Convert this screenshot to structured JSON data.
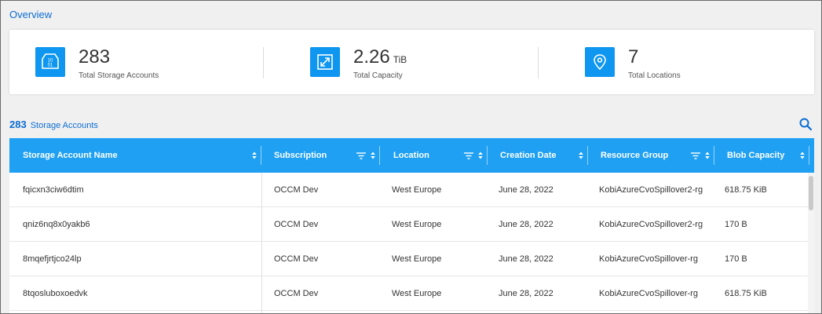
{
  "overview": {
    "title": "Overview"
  },
  "stats": [
    {
      "icon": "storage-account-icon",
      "value": "283",
      "unit": "",
      "caption": "Total Storage Accounts"
    },
    {
      "icon": "capacity-icon",
      "value": "2.26",
      "unit": "TiB",
      "caption": "Total Capacity"
    },
    {
      "icon": "location-pin-icon",
      "value": "7",
      "unit": "",
      "caption": "Total Locations"
    }
  ],
  "list": {
    "count": "283",
    "label": "Storage Accounts"
  },
  "colors": {
    "accent": "#0c6dd4",
    "header": "#1fa0f2",
    "tile": "#0e96f0"
  },
  "table": {
    "columns": [
      {
        "label": "Storage Account Name",
        "filter": false
      },
      {
        "label": "Subscription",
        "filter": true
      },
      {
        "label": "Location",
        "filter": true
      },
      {
        "label": "Creation Date",
        "filter": false
      },
      {
        "label": "Resource Group",
        "filter": true
      },
      {
        "label": "Blob Capacity",
        "filter": false
      }
    ],
    "rows": [
      [
        "fqicxn3ciw6dtim",
        "OCCM Dev",
        "West Europe",
        "June 28, 2022",
        "KobiAzureCvoSpillover2-rg",
        "618.75 KiB"
      ],
      [
        "qniz6nq8x0yakb6",
        "OCCM Dev",
        "West Europe",
        "June 28, 2022",
        "KobiAzureCvoSpillover2-rg",
        "170 B"
      ],
      [
        "8mqefjrtjco24lp",
        "OCCM Dev",
        "West Europe",
        "June 28, 2022",
        "KobiAzureCvoSpillover-rg",
        "170 B"
      ],
      [
        "8tqosluboxoedvk",
        "OCCM Dev",
        "West Europe",
        "June 28, 2022",
        "KobiAzureCvoSpillover-rg",
        "618.75 KiB"
      ]
    ]
  }
}
